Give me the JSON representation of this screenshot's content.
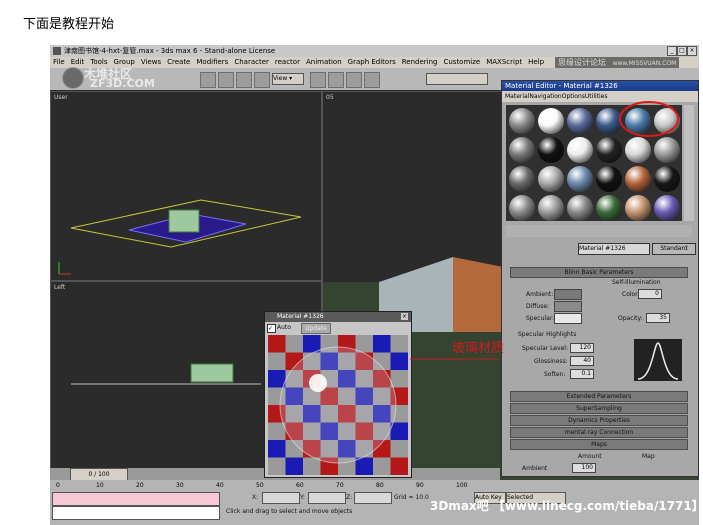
{
  "heading": "下面是教程开始",
  "app": {
    "title": "津南图书馆-4-hxt-复管.max - 3ds max 6 - Stand-alone License",
    "forum_watermark": "思缘设计论坛",
    "forum_url": "www.MISSVUAN.COM",
    "logo_top": "木堆社区",
    "logo_bottom": "ZF3D.COM",
    "menu": [
      "File",
      "Edit",
      "Tools",
      "Group",
      "Views",
      "Create",
      "Modifiers",
      "Character",
      "reactor",
      "Animation",
      "Graph Editors",
      "Rendering",
      "Customize",
      "MAXScript",
      "Help"
    ],
    "view_dropdown": "View",
    "viewport_labels": {
      "top": "User",
      "left": "Left",
      "persp": "05"
    },
    "timeline": {
      "frame": "0 / 100",
      "ticks": [
        "0",
        "10",
        "20",
        "30",
        "40",
        "50",
        "60",
        "70",
        "80",
        "90",
        "100"
      ]
    },
    "status": {
      "x_label": "X:",
      "y_label": "Y:",
      "z_label": "Z:",
      "grid": "Grid = 10.0",
      "autokey": "Auto Key",
      "selected": "Selected",
      "prompt": "Click and drag to select and move objects"
    },
    "bottom_watermark": "3Dmax吧 【www.linecg.com/tieba/1771】"
  },
  "material_editor": {
    "title": "Material Editor - Material #1326",
    "menu": [
      "Material",
      "Navigation",
      "Options",
      "Utilities"
    ],
    "material_name": "Material #1326",
    "type_button": "Standard",
    "rollouts": {
      "blinn": "Blinn Basic Parameters",
      "self_illum": "Self-Illumination",
      "specular_highlights": "Specular Highlights",
      "extended": "Extended Parameters",
      "supersampling": "SuperSampling",
      "dynamics": "Dynamics Properties",
      "mental_ray": "mental ray Connection",
      "maps": "Maps"
    },
    "labels": {
      "ambient": "Ambient:",
      "diffuse": "Diffuse:",
      "specular": "Specular:",
      "color": "Color",
      "opacity": "Opacity:",
      "specular_level": "Specular Level:",
      "glossiness": "Glossiness:",
      "soften": "Soften:",
      "amount": "Amount",
      "map": "Map",
      "ambient_map": "Ambient",
      "ambient_amount": "100"
    },
    "values": {
      "color": "0",
      "opacity": "35",
      "specular_level": "120",
      "glossiness": "40",
      "soften": "0.1"
    }
  },
  "material_preview": {
    "title": "Material #1326",
    "auto_label": "Auto",
    "update_button": "Update"
  },
  "annotation": "玻璃材质"
}
